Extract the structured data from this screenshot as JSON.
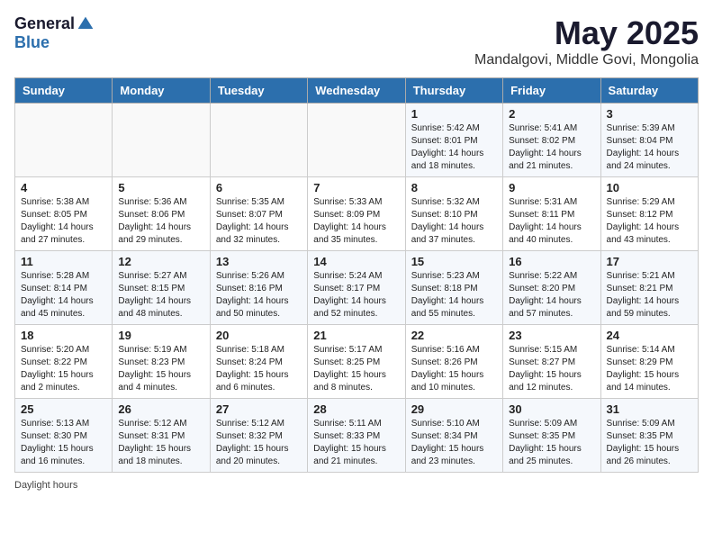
{
  "logo": {
    "general": "General",
    "blue": "Blue"
  },
  "title": "May 2025",
  "subtitle": "Mandalgovi, Middle Govi, Mongolia",
  "days_of_week": [
    "Sunday",
    "Monday",
    "Tuesday",
    "Wednesday",
    "Thursday",
    "Friday",
    "Saturday"
  ],
  "weeks": [
    [
      {
        "day": "",
        "info": ""
      },
      {
        "day": "",
        "info": ""
      },
      {
        "day": "",
        "info": ""
      },
      {
        "day": "",
        "info": ""
      },
      {
        "day": "1",
        "info": "Sunrise: 5:42 AM\nSunset: 8:01 PM\nDaylight: 14 hours\nand 18 minutes."
      },
      {
        "day": "2",
        "info": "Sunrise: 5:41 AM\nSunset: 8:02 PM\nDaylight: 14 hours\nand 21 minutes."
      },
      {
        "day": "3",
        "info": "Sunrise: 5:39 AM\nSunset: 8:04 PM\nDaylight: 14 hours\nand 24 minutes."
      }
    ],
    [
      {
        "day": "4",
        "info": "Sunrise: 5:38 AM\nSunset: 8:05 PM\nDaylight: 14 hours\nand 27 minutes."
      },
      {
        "day": "5",
        "info": "Sunrise: 5:36 AM\nSunset: 8:06 PM\nDaylight: 14 hours\nand 29 minutes."
      },
      {
        "day": "6",
        "info": "Sunrise: 5:35 AM\nSunset: 8:07 PM\nDaylight: 14 hours\nand 32 minutes."
      },
      {
        "day": "7",
        "info": "Sunrise: 5:33 AM\nSunset: 8:09 PM\nDaylight: 14 hours\nand 35 minutes."
      },
      {
        "day": "8",
        "info": "Sunrise: 5:32 AM\nSunset: 8:10 PM\nDaylight: 14 hours\nand 37 minutes."
      },
      {
        "day": "9",
        "info": "Sunrise: 5:31 AM\nSunset: 8:11 PM\nDaylight: 14 hours\nand 40 minutes."
      },
      {
        "day": "10",
        "info": "Sunrise: 5:29 AM\nSunset: 8:12 PM\nDaylight: 14 hours\nand 43 minutes."
      }
    ],
    [
      {
        "day": "11",
        "info": "Sunrise: 5:28 AM\nSunset: 8:14 PM\nDaylight: 14 hours\nand 45 minutes."
      },
      {
        "day": "12",
        "info": "Sunrise: 5:27 AM\nSunset: 8:15 PM\nDaylight: 14 hours\nand 48 minutes."
      },
      {
        "day": "13",
        "info": "Sunrise: 5:26 AM\nSunset: 8:16 PM\nDaylight: 14 hours\nand 50 minutes."
      },
      {
        "day": "14",
        "info": "Sunrise: 5:24 AM\nSunset: 8:17 PM\nDaylight: 14 hours\nand 52 minutes."
      },
      {
        "day": "15",
        "info": "Sunrise: 5:23 AM\nSunset: 8:18 PM\nDaylight: 14 hours\nand 55 minutes."
      },
      {
        "day": "16",
        "info": "Sunrise: 5:22 AM\nSunset: 8:20 PM\nDaylight: 14 hours\nand 57 minutes."
      },
      {
        "day": "17",
        "info": "Sunrise: 5:21 AM\nSunset: 8:21 PM\nDaylight: 14 hours\nand 59 minutes."
      }
    ],
    [
      {
        "day": "18",
        "info": "Sunrise: 5:20 AM\nSunset: 8:22 PM\nDaylight: 15 hours\nand 2 minutes."
      },
      {
        "day": "19",
        "info": "Sunrise: 5:19 AM\nSunset: 8:23 PM\nDaylight: 15 hours\nand 4 minutes."
      },
      {
        "day": "20",
        "info": "Sunrise: 5:18 AM\nSunset: 8:24 PM\nDaylight: 15 hours\nand 6 minutes."
      },
      {
        "day": "21",
        "info": "Sunrise: 5:17 AM\nSunset: 8:25 PM\nDaylight: 15 hours\nand 8 minutes."
      },
      {
        "day": "22",
        "info": "Sunrise: 5:16 AM\nSunset: 8:26 PM\nDaylight: 15 hours\nand 10 minutes."
      },
      {
        "day": "23",
        "info": "Sunrise: 5:15 AM\nSunset: 8:27 PM\nDaylight: 15 hours\nand 12 minutes."
      },
      {
        "day": "24",
        "info": "Sunrise: 5:14 AM\nSunset: 8:29 PM\nDaylight: 15 hours\nand 14 minutes."
      }
    ],
    [
      {
        "day": "25",
        "info": "Sunrise: 5:13 AM\nSunset: 8:30 PM\nDaylight: 15 hours\nand 16 minutes."
      },
      {
        "day": "26",
        "info": "Sunrise: 5:12 AM\nSunset: 8:31 PM\nDaylight: 15 hours\nand 18 minutes."
      },
      {
        "day": "27",
        "info": "Sunrise: 5:12 AM\nSunset: 8:32 PM\nDaylight: 15 hours\nand 20 minutes."
      },
      {
        "day": "28",
        "info": "Sunrise: 5:11 AM\nSunset: 8:33 PM\nDaylight: 15 hours\nand 21 minutes."
      },
      {
        "day": "29",
        "info": "Sunrise: 5:10 AM\nSunset: 8:34 PM\nDaylight: 15 hours\nand 23 minutes."
      },
      {
        "day": "30",
        "info": "Sunrise: 5:09 AM\nSunset: 8:35 PM\nDaylight: 15 hours\nand 25 minutes."
      },
      {
        "day": "31",
        "info": "Sunrise: 5:09 AM\nSunset: 8:35 PM\nDaylight: 15 hours\nand 26 minutes."
      }
    ]
  ],
  "footer": "Daylight hours"
}
